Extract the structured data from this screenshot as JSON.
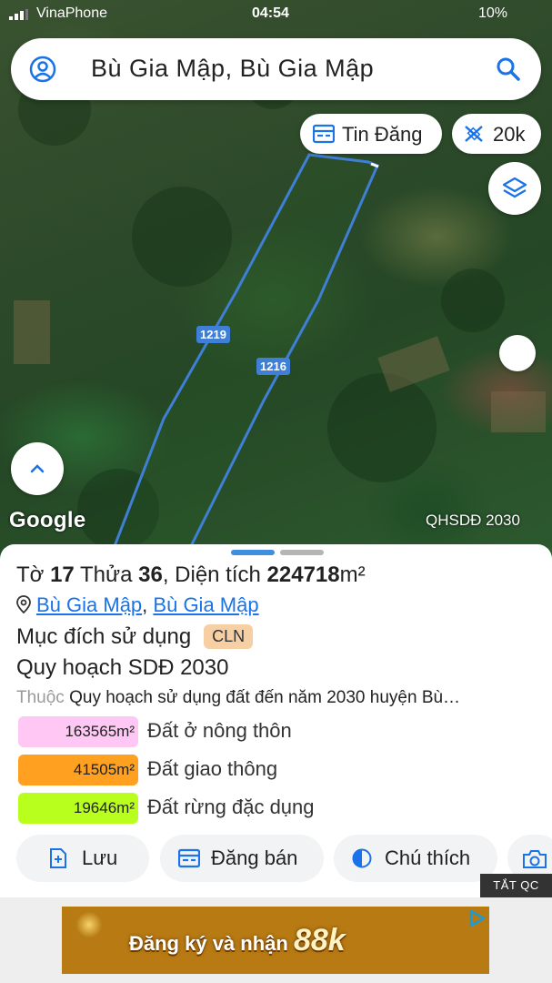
{
  "status_bar": {
    "carrier": "VinaPhone",
    "time": "04:54",
    "battery": "10%"
  },
  "search": {
    "title": "Bù Gia Mập, Bù Gia Mập"
  },
  "map": {
    "tin_dang_label": "Tin Đăng",
    "scale_label": "20k",
    "road_labels": [
      "1219",
      "1216"
    ],
    "google_label": "Google",
    "plan_label": "QHSDĐ 2030",
    "colors": {
      "boundary": "#3f7fd6",
      "accent": "#1a73e8"
    }
  },
  "parcel": {
    "to_label": "Tờ",
    "to_number": "17",
    "thua_label": "Thửa",
    "thua_number": "36",
    "area_label": ", Diện tích",
    "area_value": "224718",
    "area_unit": "m²",
    "location_1": "Bù Gia Mập",
    "location_sep": ",",
    "location_2": "Bù Gia Mập",
    "purpose_label": "Mục đích sử dụng",
    "purpose_code": "CLN",
    "planning_title": "Quy hoạch SDĐ 2030",
    "belongs_label": "Thuộc",
    "belongs_value": "Quy hoạch sử dụng đất đến năm 2030 huyện Bù…"
  },
  "land_areas": [
    {
      "value": "163565m²",
      "name": "Đất ở nông thôn",
      "color": "#ffc8f4"
    },
    {
      "value": "41505m²",
      "name": "Đất giao thông",
      "color": "#ffa020"
    },
    {
      "value": "19646m²",
      "name": "Đất rừng đặc dụng",
      "color": "#b8ff1e"
    }
  ],
  "actions": {
    "save": "Lưu",
    "sell": "Đăng bán",
    "note": "Chú thích"
  },
  "ad": {
    "close_label": "TẮT QC",
    "text": "Đăng ký và nhận",
    "highlight": "88k"
  }
}
